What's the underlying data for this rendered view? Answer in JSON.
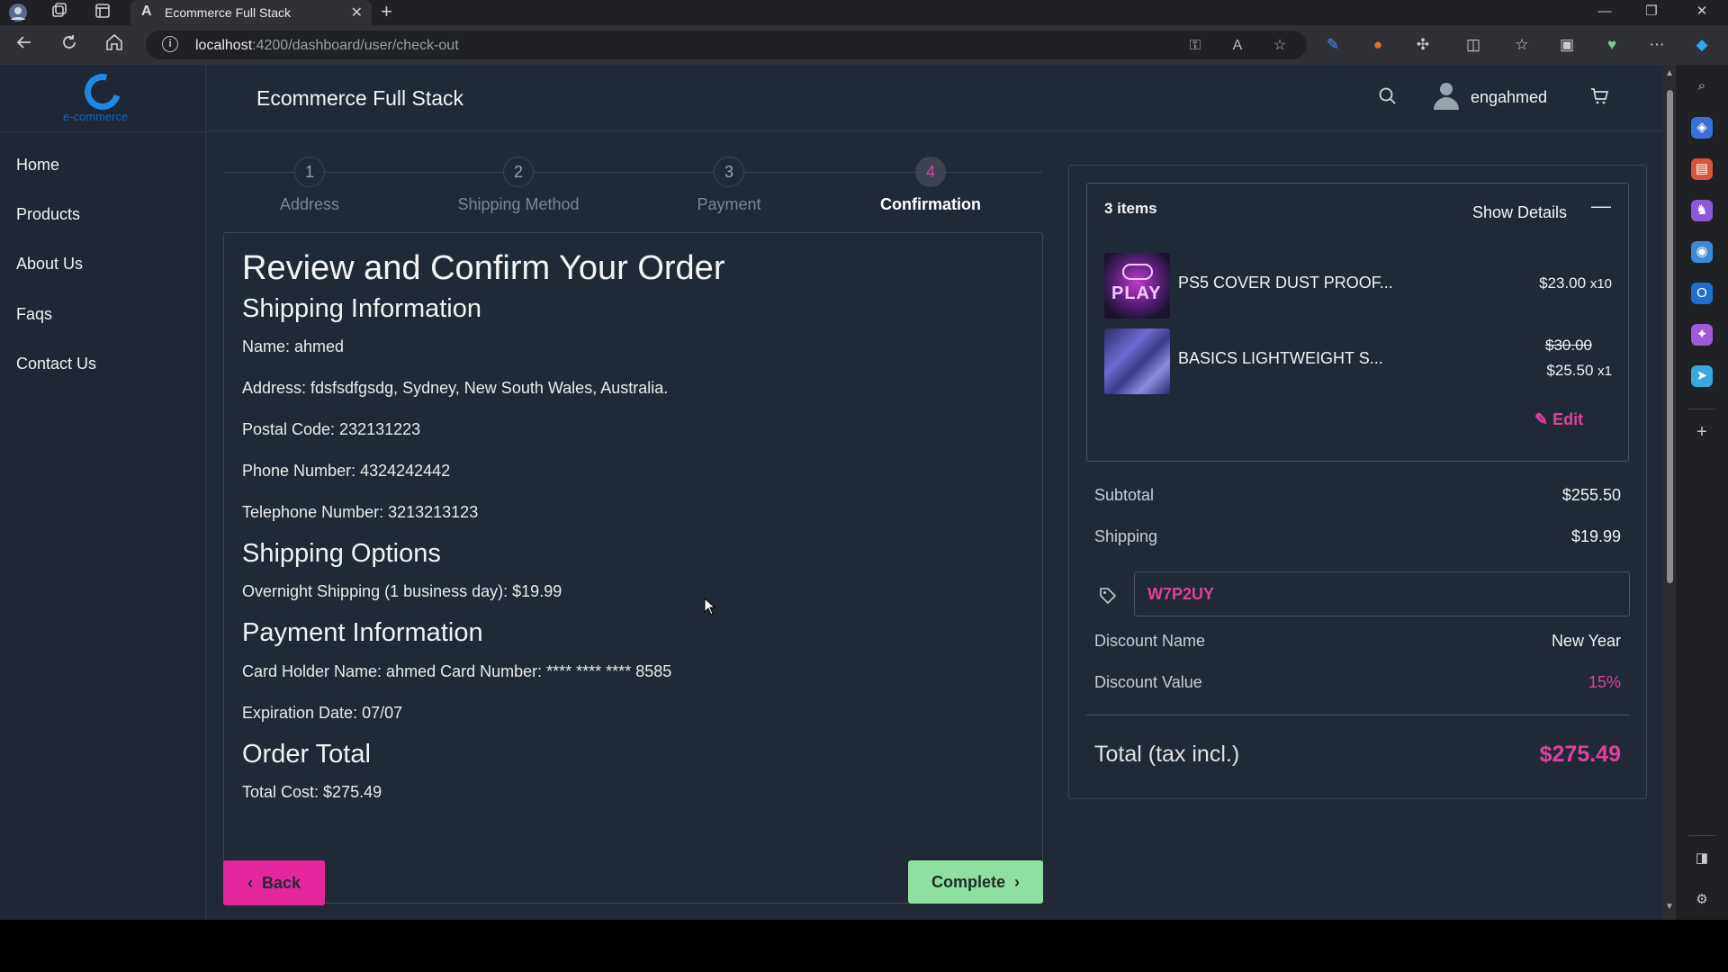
{
  "browser": {
    "tab_title": "Ecommerce Full Stack",
    "tab_favicon": "A",
    "url_host": "localhost",
    "url_path": ":4200/dashboard/user/check-out"
  },
  "app": {
    "title": "Ecommerce Full Stack",
    "logo_text": "e-commerce",
    "username": "engahmed"
  },
  "sidebar": {
    "items": [
      {
        "label": "Home"
      },
      {
        "label": "Products"
      },
      {
        "label": "About Us"
      },
      {
        "label": "Faqs"
      },
      {
        "label": "Contact Us"
      }
    ]
  },
  "stepper": {
    "steps": [
      {
        "number": "1",
        "label": "Address"
      },
      {
        "number": "2",
        "label": "Shipping Method"
      },
      {
        "number": "3",
        "label": "Payment"
      },
      {
        "number": "4",
        "label": "Confirmation"
      }
    ],
    "active_step": 4
  },
  "review": {
    "title": "Review and Confirm Your Order",
    "shipping_heading": "Shipping Information",
    "name": "Name: ahmed",
    "address": "Address: fdsfsdfgsdg, Sydney, New South Wales, Australia.",
    "postal_code": "Postal Code: 232131223",
    "phone": "Phone Number: 4324242442",
    "telephone": "Telephone Number: 3213213123",
    "options_heading": "Shipping Options",
    "shipping_option": "Overnight Shipping (1 business day): $19.99",
    "payment_heading": "Payment Information",
    "card": "Card Holder Name: ahmed Card Number: **** **** **** 8585",
    "expiration": "Expiration Date: 07/07",
    "total_heading": "Order Total",
    "total_cost": "Total Cost: $275.49"
  },
  "buttons": {
    "back": "Back",
    "complete": "Complete"
  },
  "summary": {
    "items_count": "3 items",
    "show_details": "Show Details",
    "products": [
      {
        "name": "PS5 COVER DUST PROOF...",
        "image_text": "PLAY",
        "price": "$23.00",
        "qty": "x10"
      },
      {
        "name": "BASICS LIGHTWEIGHT S...",
        "old_price": "$30.00",
        "price": "$25.50",
        "qty": "x1"
      }
    ],
    "edit": "Edit",
    "subtotal_label": "Subtotal",
    "subtotal_value": "$255.50",
    "shipping_label": "Shipping",
    "shipping_value": "$19.99",
    "coupon_value": "W7P2UY",
    "discount_name_label": "Discount Name",
    "discount_name_value": "New Year",
    "discount_value_label": "Discount Value",
    "discount_value": "15%",
    "total_label": "Total (tax incl.)",
    "total_value": "$275.49"
  },
  "colors": {
    "accent": "#e0409f",
    "complete_button": "#8de09f",
    "background": "#202a36"
  }
}
